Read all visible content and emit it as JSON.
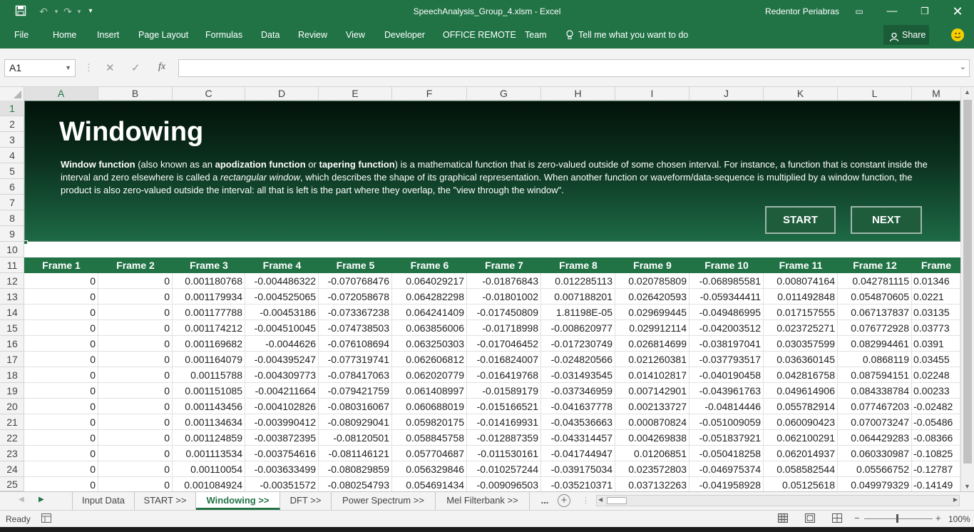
{
  "window": {
    "title": "SpeechAnalysis_Group_4.xlsm  -  Excel",
    "user": "Redentor Periabras"
  },
  "qat": {
    "save_icon": "save-icon",
    "undo_icon": "undo-icon",
    "redo_icon": "redo-icon",
    "customize_icon": "chevron-down-icon"
  },
  "ribbon": {
    "tabs": [
      "File",
      "Home",
      "Insert",
      "Page Layout",
      "Formulas",
      "Data",
      "Review",
      "View",
      "Developer",
      "OFFICE REMOTE",
      "Team"
    ],
    "tell_me": "Tell me what you want to do",
    "share": "Share"
  },
  "formula_bar": {
    "name_box": "A1",
    "fx": "fx",
    "content": ""
  },
  "columns": [
    "A",
    "B",
    "C",
    "D",
    "E",
    "F",
    "G",
    "H",
    "I",
    "J",
    "K",
    "L",
    "M"
  ],
  "rows": [
    "1",
    "2",
    "3",
    "4",
    "5",
    "6",
    "7",
    "8",
    "9",
    "10",
    "11",
    "12",
    "13",
    "14",
    "15",
    "16",
    "17",
    "18",
    "19",
    "20",
    "21",
    "22",
    "23",
    "24",
    "25"
  ],
  "banner": {
    "title": "Windowing",
    "desc_p1_bold": "Window function",
    "desc_p2": " (also known as an ",
    "desc_p3_bold": "apodization function",
    "desc_p4": " or ",
    "desc_p5_bold": "tapering function",
    "desc_p6": ") is a mathematical function that is zero-valued outside of some chosen interval. For instance, a function that is constant inside the interval and zero elsewhere is called a ",
    "desc_p7_italic": "rectangular window",
    "desc_p8": ", which describes the shape of its graphical representation. When another function or waveform/data-sequence is multiplied by a window function, the product is also zero-valued outside the interval: all that is left is the part where they overlap, the \"view through the window\".",
    "start": "START",
    "next": "NEXT"
  },
  "table": {
    "headers": [
      "Frame  1",
      "Frame  2",
      "Frame  3",
      "Frame  4",
      "Frame  5",
      "Frame  6",
      "Frame  7",
      "Frame  8",
      "Frame  9",
      "Frame  10",
      "Frame  11",
      "Frame  12",
      "Frame"
    ],
    "rows": [
      [
        "0",
        "0",
        "0.001180768",
        "-0.004486322",
        "-0.070768476",
        "0.064029217",
        "-0.01876843",
        "0.012285113",
        "0.020785809",
        "-0.068985581",
        "0.008074164",
        "0.042781115",
        "0.01346"
      ],
      [
        "0",
        "0",
        "0.001179934",
        "-0.004525065",
        "-0.072058678",
        "0.064282298",
        "-0.01801002",
        "0.007188201",
        "0.026420593",
        "-0.059344411",
        "0.011492848",
        "0.054870605",
        "0.0221"
      ],
      [
        "0",
        "0",
        "0.001177788",
        "-0.00453186",
        "-0.073367238",
        "0.064241409",
        "-0.017450809",
        "1.81198E-05",
        "0.029699445",
        "-0.049486995",
        "0.017157555",
        "0.067137837",
        "0.03135"
      ],
      [
        "0",
        "0",
        "0.001174212",
        "-0.004510045",
        "-0.074738503",
        "0.063856006",
        "-0.01718998",
        "-0.008620977",
        "0.029912114",
        "-0.042003512",
        "0.023725271",
        "0.076772928",
        "0.03773"
      ],
      [
        "0",
        "0",
        "0.001169682",
        "-0.0044626",
        "-0.076108694",
        "0.063250303",
        "-0.017046452",
        "-0.017230749",
        "0.026814699",
        "-0.038197041",
        "0.030357599",
        "0.082994461",
        "0.0391"
      ],
      [
        "0",
        "0",
        "0.001164079",
        "-0.004395247",
        "-0.077319741",
        "0.062606812",
        "-0.016824007",
        "-0.024820566",
        "0.021260381",
        "-0.037793517",
        "0.036360145",
        "0.0868119",
        "0.03455"
      ],
      [
        "0",
        "0",
        "0.00115788",
        "-0.004309773",
        "-0.078417063",
        "0.062020779",
        "-0.016419768",
        "-0.031493545",
        "0.014102817",
        "-0.040190458",
        "0.042816758",
        "0.087594151",
        "0.02248"
      ],
      [
        "0",
        "0",
        "0.001151085",
        "-0.004211664",
        "-0.079421759",
        "0.061408997",
        "-0.01589179",
        "-0.037346959",
        "0.007142901",
        "-0.043961763",
        "0.049614906",
        "0.084338784",
        "0.00233"
      ],
      [
        "0",
        "0",
        "0.001143456",
        "-0.004102826",
        "-0.080316067",
        "0.060688019",
        "-0.015166521",
        "-0.041637778",
        "0.002133727",
        "-0.04814446",
        "0.055782914",
        "0.077467203",
        "-0.02482"
      ],
      [
        "0",
        "0",
        "0.001134634",
        "-0.003990412",
        "-0.080929041",
        "0.059820175",
        "-0.014169931",
        "-0.043536663",
        "0.000870824",
        "-0.051009059",
        "0.060090423",
        "0.070073247",
        "-0.05486"
      ],
      [
        "0",
        "0",
        "0.001124859",
        "-0.003872395",
        "-0.08120501",
        "0.058845758",
        "-0.012887359",
        "-0.043314457",
        "0.004269838",
        "-0.051837921",
        "0.062100291",
        "0.064429283",
        "-0.08366"
      ],
      [
        "0",
        "0",
        "0.001113534",
        "-0.003754616",
        "-0.081146121",
        "0.057704687",
        "-0.011530161",
        "-0.041744947",
        "0.01206851",
        "-0.050418258",
        "0.062014937",
        "0.060330987",
        "-0.10825"
      ],
      [
        "0",
        "0",
        "0.00110054",
        "-0.003633499",
        "-0.080829859",
        "0.056329846",
        "-0.010257244",
        "-0.039175034",
        "0.023572803",
        "-0.046975374",
        "0.058582544",
        "0.05566752",
        "-0.12787"
      ],
      [
        "0",
        "0",
        "0.001084924",
        "-0.00351572",
        "-0.080254793",
        "0.054691434",
        "-0.009096503",
        "-0.035210371",
        "0.037132263",
        "-0.041958928",
        "0.05125618",
        "0.049979329",
        "-0.14149"
      ]
    ]
  },
  "sheets": {
    "tabs": [
      "Input Data",
      "START >>",
      "Windowing >>",
      "DFT >>",
      "Power Spectrum >>",
      "Mel Filterbank >>"
    ],
    "active": "Windowing >>",
    "more": "..."
  },
  "status": {
    "text": "Ready",
    "zoom": "100%"
  }
}
